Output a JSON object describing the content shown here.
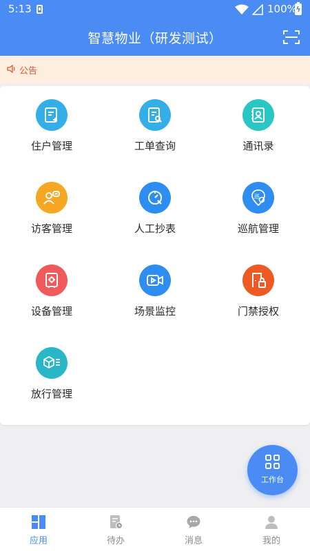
{
  "status_bar": {
    "time": "5:13",
    "battery": "100%"
  },
  "header": {
    "title": "智慧物业（研发测试）",
    "scan_icon": "scan-icon"
  },
  "notice": {
    "label": "公告",
    "icon": "speaker-icon"
  },
  "grid": [
    {
      "label": "住户管理",
      "icon": "document-add-icon",
      "color": "#34aee6"
    },
    {
      "label": "工单查询",
      "icon": "document-search-icon",
      "color": "#34aee6"
    },
    {
      "label": "通讯录",
      "icon": "contact-book-icon",
      "color": "#29c6c4"
    },
    {
      "label": "访客管理",
      "icon": "visitor-icon",
      "color": "#f5a623"
    },
    {
      "label": "人工抄表",
      "icon": "meter-icon",
      "color": "#2d8df0"
    },
    {
      "label": "巡航管理",
      "icon": "patrol-icon",
      "color": "#2d8df0",
      "glyph": "巡"
    },
    {
      "label": "设备管理",
      "icon": "device-icon",
      "color": "#f15a5a"
    },
    {
      "label": "场景监控",
      "icon": "video-camera-icon",
      "color": "#2d8df0"
    },
    {
      "label": "门禁授权",
      "icon": "door-lock-icon",
      "color": "#ee5a24"
    },
    {
      "label": "放行管理",
      "icon": "cube-release-icon",
      "color": "#29b6c6"
    }
  ],
  "fab": {
    "label": "工作台",
    "icon": "workbench-grid-icon"
  },
  "tabs": [
    {
      "label": "应用",
      "icon": "apps-icon",
      "active": true
    },
    {
      "label": "待办",
      "icon": "todo-icon",
      "active": false
    },
    {
      "label": "消息",
      "icon": "message-icon",
      "active": false
    },
    {
      "label": "我的",
      "icon": "profile-icon",
      "active": false
    }
  ],
  "colors": {
    "primary": "#4a8cf3",
    "notice_bg": "#fdeedd",
    "notice_text": "#e2543c",
    "tab_inactive": "#8b8b8b"
  }
}
